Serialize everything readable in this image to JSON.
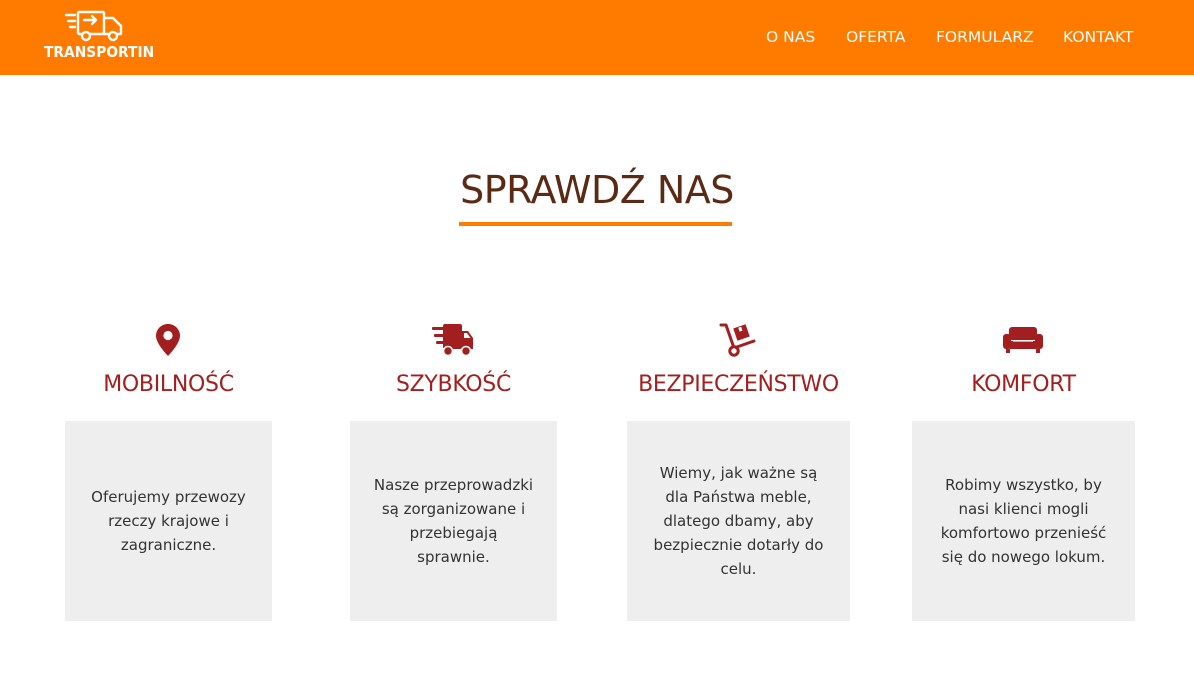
{
  "brand": {
    "name": "TRANSPORTIN",
    "logo_icon": "moving-truck-icon"
  },
  "colors": {
    "header": "#ff7b00",
    "title": "#5b2a14",
    "accent": "#a31f1f",
    "card": "#eeeeee"
  },
  "nav": {
    "items": [
      {
        "label": "O NAS"
      },
      {
        "label": "OFERTA"
      },
      {
        "label": "FORMULARZ"
      },
      {
        "label": "KONTAKT"
      }
    ]
  },
  "section": {
    "title": "SPRAWDŹ NAS"
  },
  "features": [
    {
      "icon": "map-marker-icon",
      "title": "MOBILNOŚĆ",
      "text": "Oferujemy przewozy rzeczy krajowe i zagraniczne."
    },
    {
      "icon": "fast-truck-icon",
      "title": "SZYBKOŚĆ",
      "text": "Nasze przeprowadzki są zorganizowane i przebiegają sprawnie."
    },
    {
      "icon": "hand-truck-icon",
      "title": "BEZPIECZEŃSTWO",
      "text": "Wiemy, jak ważne są dla Państwa meble, dlatego dbamy, aby bezpiecznie dotarły do celu."
    },
    {
      "icon": "sofa-icon",
      "title": "KOMFORT",
      "text": "Robimy wszystko, by nasi klienci mogli komfortowo przenieść się do nowego lokum."
    }
  ]
}
